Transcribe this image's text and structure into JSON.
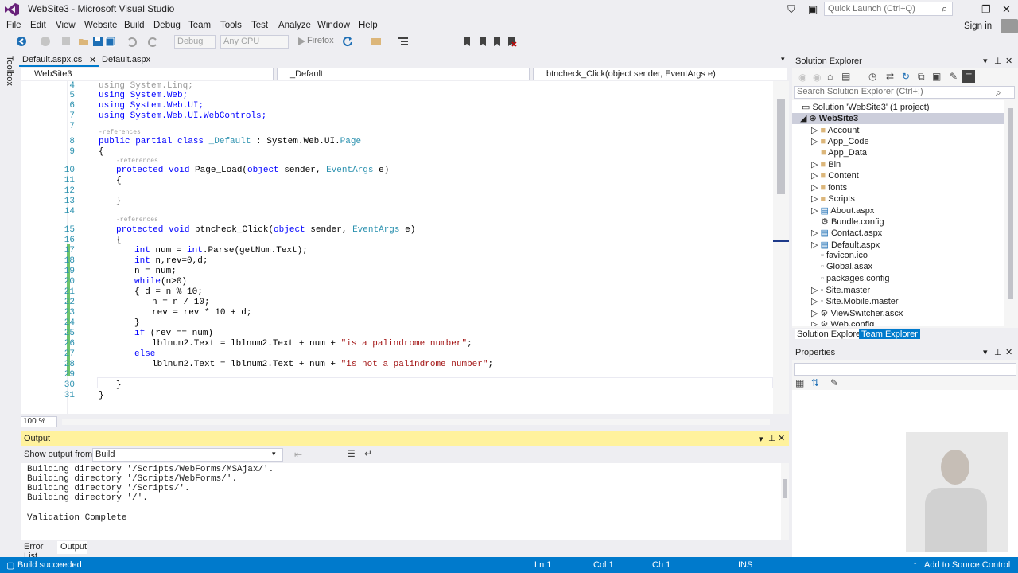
{
  "window": {
    "title": "WebSite3 - Microsoft Visual Studio",
    "quick_launch": "Quick Launch (Ctrl+Q)",
    "sign_in": "Sign in"
  },
  "menu": [
    "File",
    "Edit",
    "View",
    "Website",
    "Build",
    "Debug",
    "Team",
    "Tools",
    "Test",
    "Analyze",
    "Window",
    "Help"
  ],
  "toolbar": {
    "config": "Debug",
    "platform": "Any CPU",
    "browser": "Firefox"
  },
  "toolbox_label": "Toolbox",
  "doc_tabs": [
    "Default.aspx.cs",
    "Default.aspx"
  ],
  "nav": {
    "project": "WebSite3",
    "class": "_Default",
    "member": "btncheck_Click(object sender, EventArgs e)"
  },
  "code_lines": [
    {
      "n": "5",
      "t": "using System.Web;"
    },
    {
      "n": "6",
      "t": "using System.Web.UI;"
    },
    {
      "n": "7",
      "t": "using System.Web.UI.WebControls;"
    }
  ],
  "zoom": "100 %",
  "output": {
    "title": "Output",
    "show_from_label": "Show output from:",
    "source": "Build",
    "lines": [
      "Building directory '/Scripts/WebForms/MSAjax/'.",
      "Building directory '/Scripts/WebForms/'.",
      "Building directory '/Scripts/'.",
      "Building directory '/'.",
      "",
      "Validation Complete"
    ]
  },
  "bottom_tabs": [
    "Error List",
    "Output"
  ],
  "solution_explorer": {
    "title": "Solution Explorer",
    "search": "Search Solution Explorer (Ctrl+;)",
    "solution": "Solution 'WebSite3' (1 project)",
    "project": "WebSite3",
    "items": [
      "Account",
      "App_Code",
      "App_Data",
      "Bin",
      "Content",
      "fonts",
      "Scripts",
      "About.aspx",
      "Bundle.config",
      "Contact.aspx",
      "Default.aspx",
      "favicon.ico",
      "Global.asax",
      "packages.config",
      "Site.master",
      "Site.Mobile.master",
      "ViewSwitcher.ascx",
      "Web.config"
    ],
    "tabs": [
      "Solution Explorer",
      "Team Explorer"
    ]
  },
  "properties": {
    "title": "Properties"
  },
  "status": {
    "message": "Build succeeded",
    "ln": "Ln 1",
    "col": "Col 1",
    "ch": "Ch 1",
    "ins": "INS",
    "source_control": "Add to Source Control"
  },
  "colors": {
    "accent": "#007ACC",
    "keyword": "#0000FF",
    "type": "#2B91AF",
    "string": "#A31515",
    "output_header": "#FFF29D"
  }
}
